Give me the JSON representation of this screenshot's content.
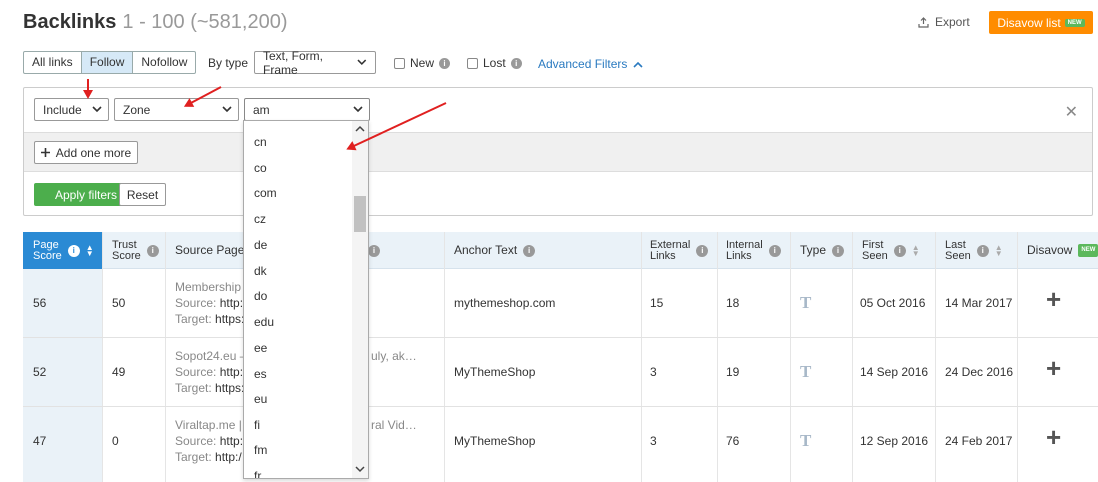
{
  "header": {
    "title": "Backlinks",
    "range": "1 - 100 (~581,200)",
    "export_label": "Export",
    "disavow_label": "Disavow list",
    "new_badge": "NEW"
  },
  "filters": {
    "tabs": [
      {
        "label": "All links"
      },
      {
        "label": "Follow"
      },
      {
        "label": "Nofollow"
      }
    ],
    "bytype_label": "By type",
    "bytype_value": "Text, Form, Frame",
    "new_label": "New",
    "lost_label": "Lost",
    "advanced_label": "Advanced Filters"
  },
  "panel": {
    "include_value": "Include",
    "zone_value": "Zone",
    "zone_filter_value": "am",
    "add_more_label": "Add one more",
    "apply_label": "Apply filters",
    "reset_label": "Reset"
  },
  "dropdown": {
    "options": [
      "cn",
      "co",
      "com",
      "cz",
      "de",
      "dk",
      "do",
      "edu",
      "ee",
      "es",
      "eu",
      "fi",
      "fm",
      "fr"
    ]
  },
  "table": {
    "headers": {
      "page_score": [
        "Page",
        "Score"
      ],
      "trust_score": [
        "Trust",
        "Score"
      ],
      "source_page": "Source Page T",
      "anchor": "Anchor Text",
      "external": [
        "External",
        "Links"
      ],
      "internal": [
        "Internal",
        "Links"
      ],
      "type": "Type",
      "first_seen": [
        "First",
        "Seen"
      ],
      "last_seen": [
        "Last",
        "Seen"
      ],
      "disavow": "Disavow"
    },
    "rows": [
      {
        "page_score": "56",
        "trust_score": "50",
        "src_title": "Membership s",
        "src_source_k": "Source:",
        "src_source_v": "http:/",
        "src_target_k": "Target:",
        "src_target_v": "https:/",
        "anchor": "mythemeshop.com",
        "external": "15",
        "internal": "18",
        "first_seen": "05 Oct 2016",
        "last_seen": "14 Mar 2017"
      },
      {
        "page_score": "52",
        "trust_score": "49",
        "src_title": "Sopot24.eu –",
        "src_title_tail": "uly, ak…",
        "src_source_k": "Source:",
        "src_source_v": "http:/",
        "src_target_k": "Target:",
        "src_target_v": "https:/",
        "anchor": "MyThemeShop",
        "external": "3",
        "internal": "19",
        "first_seen": "14 Sep 2016",
        "last_seen": "24 Dec 2016"
      },
      {
        "page_score": "47",
        "trust_score": "0",
        "src_title": "Viraltap.me | (",
        "src_title_tail": "ral Vid…",
        "src_source_k": "Source:",
        "src_source_v": "http:/",
        "src_target_k": "Target:",
        "src_target_v": "http:/",
        "anchor": "MyThemeShop",
        "external": "3",
        "internal": "76",
        "first_seen": "12 Sep 2016",
        "last_seen": "24 Feb 2017"
      }
    ]
  },
  "colors": {
    "accent": "#2a8ad4",
    "orange": "#ff8c00",
    "green": "#4cae4c",
    "arrow": "#e02020"
  }
}
